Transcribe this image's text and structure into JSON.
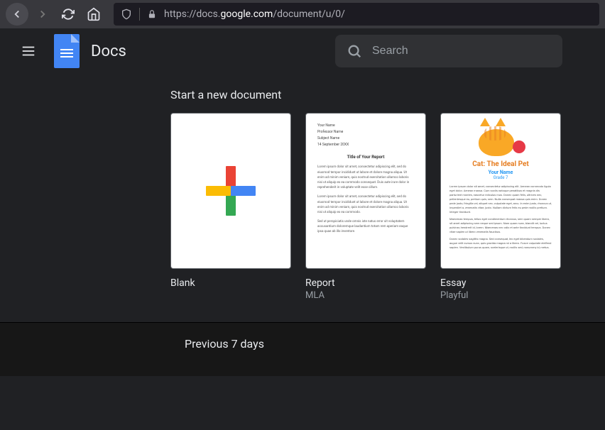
{
  "browser": {
    "url_prefix": "https://docs.",
    "url_domain": "google.com",
    "url_path": "/document/u/0/"
  },
  "header": {
    "app_title": "Docs",
    "search_placeholder": "Search"
  },
  "templates_section": {
    "title": "Start a new document",
    "items": [
      {
        "name": "Blank",
        "subtitle": ""
      },
      {
        "name": "Report",
        "subtitle": "MLA"
      },
      {
        "name": "Essay",
        "subtitle": "Playful"
      }
    ]
  },
  "essay_preview": {
    "title": "Cat: The Ideal Pet",
    "byline": "Your Name",
    "grade": "Grade 7"
  },
  "recent_section": {
    "title": "Previous 7 days"
  }
}
